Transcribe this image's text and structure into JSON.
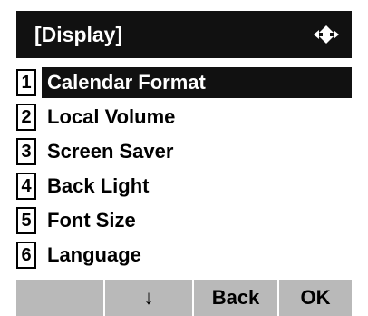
{
  "header": {
    "title": "[Display]",
    "nav_icon": "up-down-arrow-icon"
  },
  "menu": {
    "items": [
      {
        "number": "1",
        "label": "Calendar Format",
        "selected": true
      },
      {
        "number": "2",
        "label": "Local Volume",
        "selected": false
      },
      {
        "number": "3",
        "label": "Screen Saver",
        "selected": false
      },
      {
        "number": "4",
        "label": "Back Light",
        "selected": false
      },
      {
        "number": "5",
        "label": "Font Size",
        "selected": false
      },
      {
        "number": "6",
        "label": "Language",
        "selected": false
      }
    ]
  },
  "softkeys": {
    "key1": "",
    "key2": "↓",
    "key3": "Back",
    "key4": "OK"
  },
  "colors": {
    "titlebar": "#111111",
    "selected_row": "#111111",
    "softkey_bar": "#b9b9b9"
  }
}
